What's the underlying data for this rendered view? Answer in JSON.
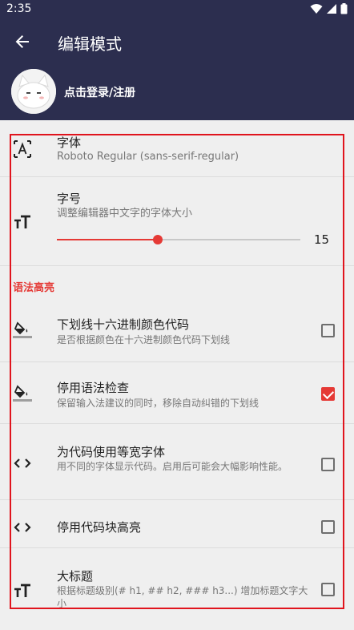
{
  "status_bar": {
    "time": "2:35"
  },
  "app_bar": {
    "title": "编辑模式"
  },
  "profile": {
    "login_text": "点击登录/注册"
  },
  "settings": {
    "font": {
      "title": "字体",
      "subtitle": "Roboto Regular (sans-serif-regular)"
    },
    "font_size": {
      "title": "字号",
      "subtitle": "调整编辑器中文字的字体大小",
      "value": "15",
      "slider_fraction": 0.415
    },
    "section_syntax": "语法高亮",
    "items": [
      {
        "title": "下划线十六进制颜色代码",
        "subtitle": "是否根据颜色在十六进制颜色代码下划线",
        "checked": false
      },
      {
        "title": "停用语法检查",
        "subtitle": "保留输入法建议的同时，移除自动纠错的下划线",
        "checked": true
      },
      {
        "title": "为代码使用等宽字体",
        "subtitle": "用不同的字体显示代码。启用后可能会大幅影响性能。",
        "checked": false
      },
      {
        "title": "停用代码块高亮",
        "subtitle": "",
        "checked": false
      },
      {
        "title": "大标题",
        "subtitle": "根据标题级别(# h1, ## h2, ### h3...) 增加标题文字大小",
        "checked": false
      }
    ]
  },
  "colors": {
    "bar": "#2c2e4f",
    "accent": "#e53935",
    "background": "#efefef"
  },
  "icons": [
    "back-arrow-icon",
    "wifi-icon",
    "signal-icon",
    "battery-icon",
    "font-icon",
    "text-size-icon",
    "fill-drip-icon",
    "code-icon"
  ]
}
